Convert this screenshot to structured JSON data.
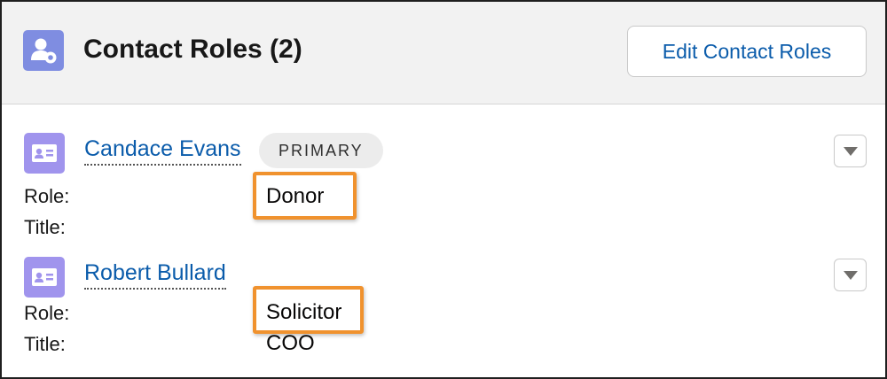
{
  "header": {
    "title": "Contact Roles (2)",
    "icon": "contact-roles-icon",
    "edit_button_label": "Edit Contact Roles"
  },
  "contacts": [
    {
      "name": "Candace Evans",
      "badge": "PRIMARY",
      "role_label": "Role:",
      "role_value": "Donor",
      "title_label": "Title:",
      "title_value": ""
    },
    {
      "name": "Robert Bullard",
      "badge": "",
      "role_label": "Role:",
      "role_value": "Solicitor",
      "title_label": "Title:",
      "title_value": "COO"
    }
  ],
  "colors": {
    "header_icon_bg": "#7f8de1",
    "contact_icon_bg": "#a094ed",
    "link": "#0b5cab",
    "highlight": "#f0922e"
  }
}
